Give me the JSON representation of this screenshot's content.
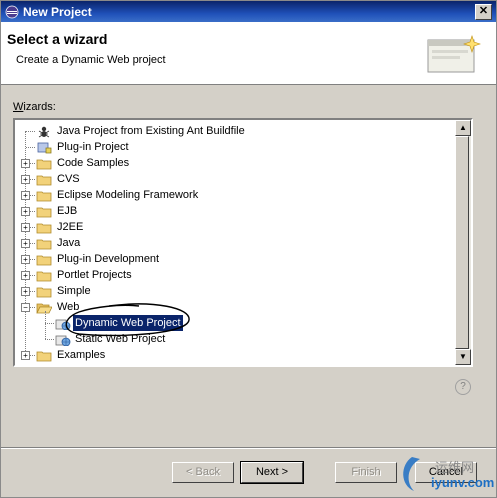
{
  "window": {
    "title": "New Project",
    "close_glyph": "✕"
  },
  "header": {
    "title": "Select a wizard",
    "description": "Create a Dynamic Web project"
  },
  "wizards_label": {
    "prefix": "W",
    "rest": "izards:"
  },
  "tree": {
    "items": [
      {
        "label": "Java Project from Existing Ant Buildfile",
        "expander": "",
        "icon": "ant-project-icon",
        "level": 0
      },
      {
        "label": "Plug-in Project",
        "expander": "",
        "icon": "plugin-project-icon",
        "level": 0
      },
      {
        "label": "Code Samples",
        "expander": "+",
        "icon": "folder-icon",
        "level": 0
      },
      {
        "label": "CVS",
        "expander": "+",
        "icon": "folder-icon",
        "level": 0
      },
      {
        "label": "Eclipse Modeling Framework",
        "expander": "+",
        "icon": "folder-icon",
        "level": 0
      },
      {
        "label": "EJB",
        "expander": "+",
        "icon": "folder-icon",
        "level": 0
      },
      {
        "label": "J2EE",
        "expander": "+",
        "icon": "folder-icon",
        "level": 0
      },
      {
        "label": "Java",
        "expander": "+",
        "icon": "folder-icon",
        "level": 0
      },
      {
        "label": "Plug-in Development",
        "expander": "+",
        "icon": "folder-icon",
        "level": 0
      },
      {
        "label": "Portlet Projects",
        "expander": "+",
        "icon": "folder-icon",
        "level": 0
      },
      {
        "label": "Simple",
        "expander": "+",
        "icon": "folder-icon",
        "level": 0
      },
      {
        "label": "Web",
        "expander": "−",
        "icon": "folder-open-icon",
        "level": 0
      },
      {
        "label": "Dynamic Web Project",
        "expander": "",
        "icon": "web-project-icon",
        "level": 1,
        "selected": true
      },
      {
        "label": "Static Web Project",
        "expander": "",
        "icon": "web-project-icon",
        "level": 1
      },
      {
        "label": "Examples",
        "expander": "+",
        "icon": "folder-icon",
        "level": 0
      }
    ]
  },
  "scroll": {
    "up_glyph": "▲",
    "down_glyph": "▼"
  },
  "help_glyph": "?",
  "buttons": {
    "back": "< Back",
    "next": "Next >",
    "finish": "Finish",
    "cancel": "Cancel"
  },
  "watermark": {
    "line1": "运维网",
    "line2": "iyunv.com"
  },
  "colors": {
    "titlebar": "#0a246a",
    "selection": "#0a246a",
    "folder": "#f2d27a",
    "dialog": "#d4d0c8"
  }
}
